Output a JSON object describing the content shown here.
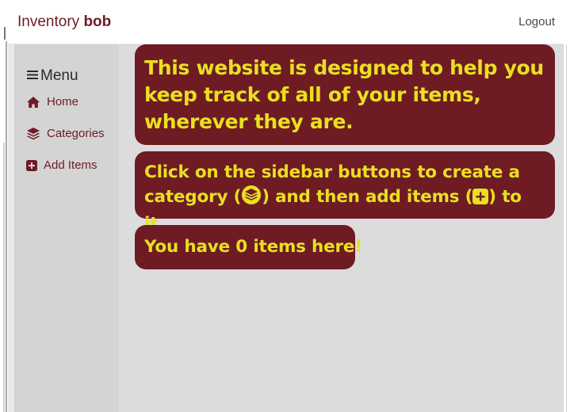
{
  "navbar": {
    "brand_prefix": "Inventory",
    "brand_user": "bob",
    "logout_label": "Logout"
  },
  "sidebar": {
    "menu_title": "Menu",
    "items": [
      {
        "label": "Home",
        "icon": "home-icon"
      },
      {
        "label": "Categories",
        "icon": "layers-icon"
      },
      {
        "label": "Add Items",
        "icon": "plus-square-icon"
      }
    ]
  },
  "main": {
    "intro_text": "This website is designed to help you keep track of all of your items, wherever they are.",
    "instructions": {
      "part1": "Click on the sidebar buttons to create a category (",
      "part2": ") and then add items (",
      "part3": ") to it."
    },
    "item_count_prefix": "You have",
    "item_count": "0",
    "item_count_suffix": "items here!"
  },
  "colors": {
    "brand": "#6f1b24",
    "card_bg": "#6f1b24",
    "card_text": "#e8e021",
    "sidebar_bg": "#d4d4d4",
    "main_bg": "#dcdcdc"
  }
}
